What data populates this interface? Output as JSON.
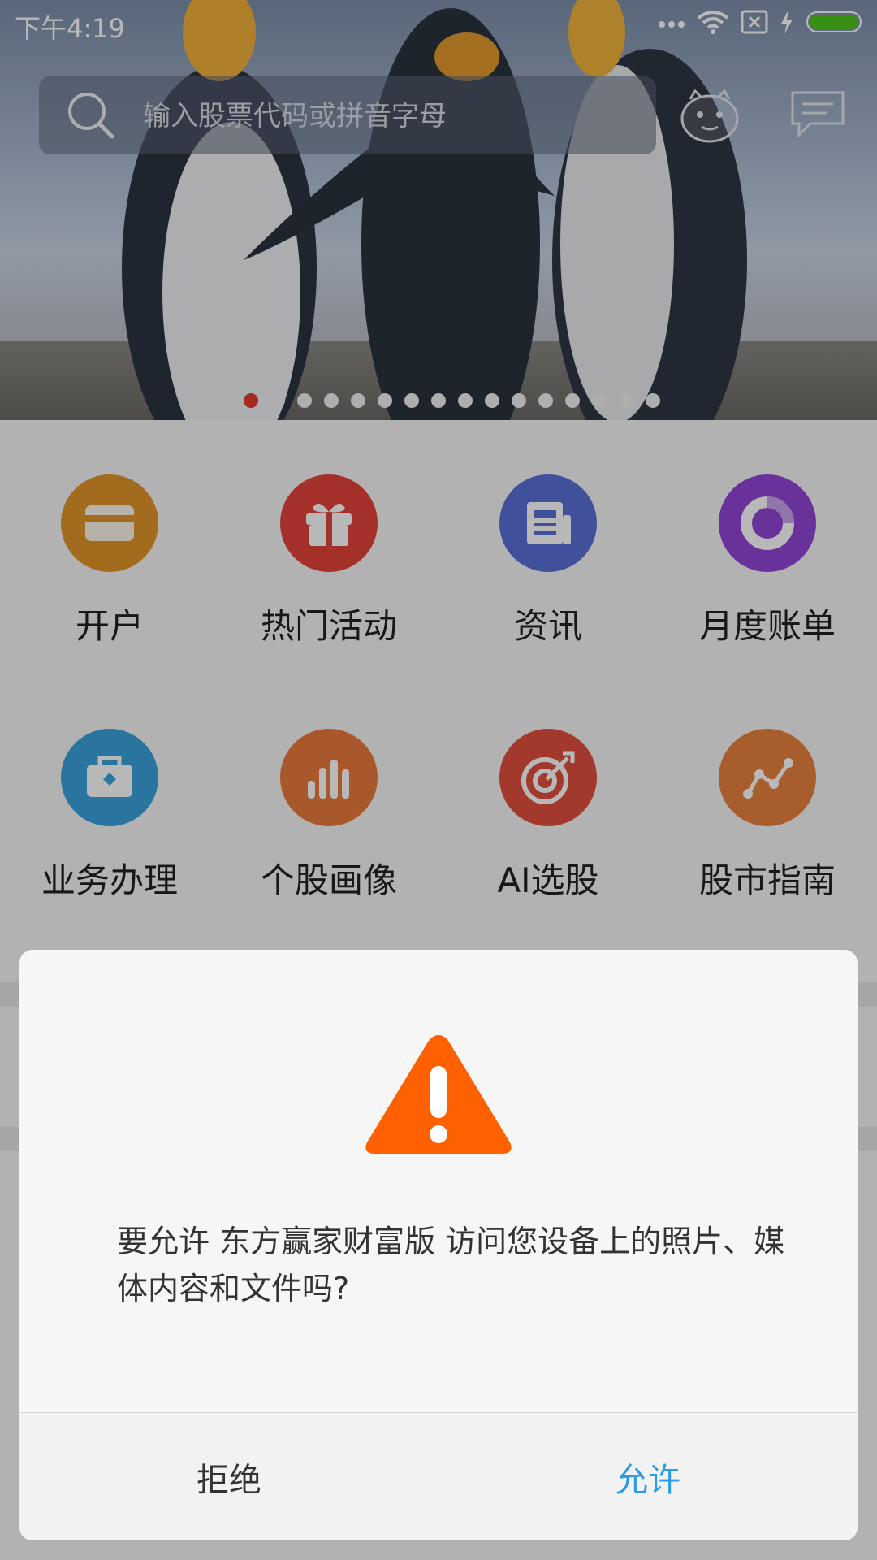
{
  "statusbar": {
    "time": "下午4:19"
  },
  "search": {
    "placeholder": "输入股票代码或拼音字母"
  },
  "banner": {
    "dot_count": 17,
    "active_dot": 1
  },
  "menu": [
    {
      "label": "开户",
      "icon": "card-icon",
      "color": "#e2952a"
    },
    {
      "label": "热门活动",
      "icon": "gift-icon",
      "color": "#e2433a"
    },
    {
      "label": "资讯",
      "icon": "newspaper-icon",
      "color": "#5a6fd6"
    },
    {
      "label": "月度账单",
      "icon": "ring-chart-icon",
      "color": "#9246d6"
    },
    {
      "label": "业务办理",
      "icon": "briefcase-icon",
      "color": "#3aa2de"
    },
    {
      "label": "个股画像",
      "icon": "bar-chart-icon",
      "color": "#ea7a3e"
    },
    {
      "label": "AI选股",
      "icon": "target-icon",
      "color": "#e2503e"
    },
    {
      "label": "股市指南",
      "icon": "line-chart-icon",
      "color": "#e8823e"
    }
  ],
  "dialog": {
    "message": "要允许 东方赢家财富版 访问您设备上的照片、媒体内容和文件吗?",
    "deny_label": "拒绝",
    "allow_label": "允许",
    "warning_color": "#ff6000",
    "allow_color": "#2b9ae8"
  }
}
